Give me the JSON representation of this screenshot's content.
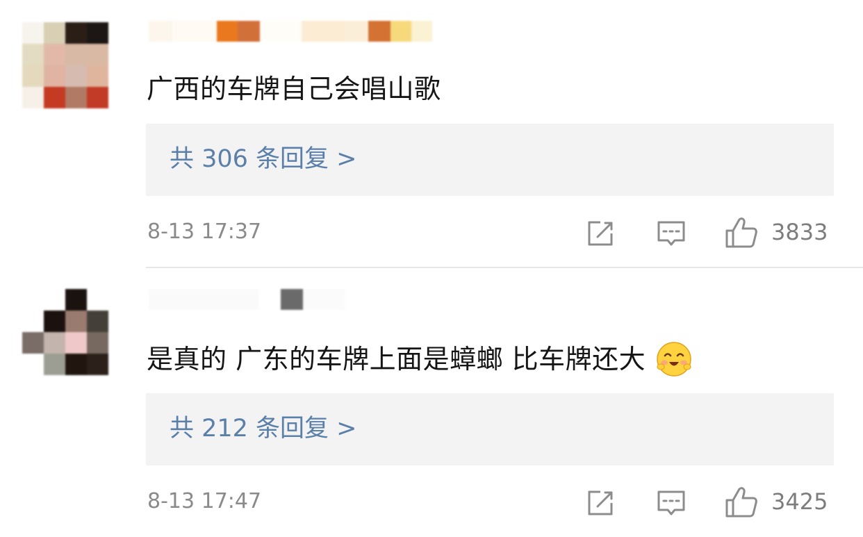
{
  "comments": [
    {
      "text": "广西的车牌自己会唱山歌",
      "replies_label": "共 306 条回复 >",
      "timestamp": "8-13 17:37",
      "like_count": "3833"
    },
    {
      "text": "是真的 广东的车牌上面是蟑螂 比车牌还大",
      "replies_label": "共 212 条回复 >",
      "timestamp": "8-13 17:47",
      "like_count": "3425",
      "emoji": "blushing-smile-emoji"
    }
  ],
  "colors": {
    "reply_link": "#5a7fa8",
    "reply_box_bg": "#f3f3f4",
    "meta_gray": "#8a8a8a"
  },
  "icons": {
    "share": "share-icon",
    "comment": "comment-icon",
    "like": "thumbs-up-icon"
  }
}
